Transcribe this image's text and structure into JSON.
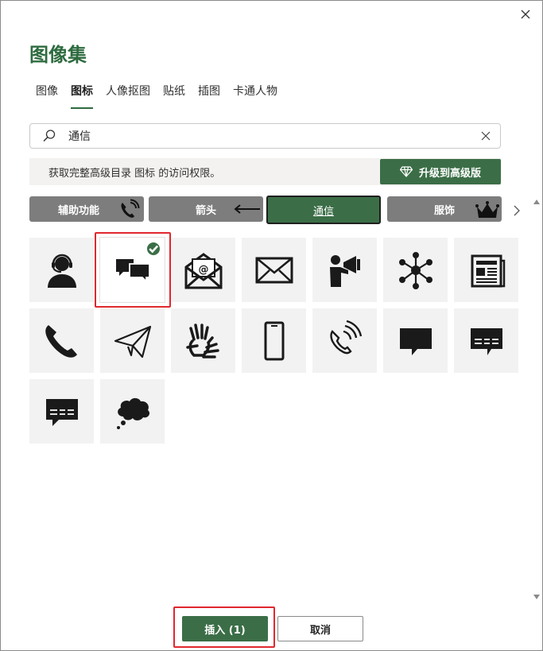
{
  "dialog": {
    "title": "图像集",
    "close_icon": "close-icon"
  },
  "tabs": [
    {
      "label": "图像",
      "active": false
    },
    {
      "label": "图标",
      "active": true
    },
    {
      "label": "人像抠图",
      "active": false
    },
    {
      "label": "贴纸",
      "active": false
    },
    {
      "label": "插图",
      "active": false
    },
    {
      "label": "卡通人物",
      "active": false
    }
  ],
  "search": {
    "value": "通信",
    "placeholder": "",
    "icon": "search-icon",
    "clear_icon": "close-icon"
  },
  "banner": {
    "message": "获取完整高级目录 图标 的访问权限。",
    "upgrade_label": "升级到高级版",
    "upgrade_icon": "diamond-icon"
  },
  "categories": [
    {
      "label": "辅助功能",
      "icon": "phone-volume-icon",
      "selected": false
    },
    {
      "label": "箭头",
      "icon": "arrow-left-icon",
      "selected": false
    },
    {
      "label": "通信",
      "icon": "",
      "selected": true
    },
    {
      "label": "服饰",
      "icon": "crown-icon",
      "selected": false
    }
  ],
  "icons": [
    {
      "name": "headset-person-icon",
      "selected": false
    },
    {
      "name": "chat-bubbles-icon",
      "selected": true
    },
    {
      "name": "open-envelope-at-icon",
      "selected": false
    },
    {
      "name": "envelope-icon",
      "selected": false
    },
    {
      "name": "person-megaphone-icon",
      "selected": false
    },
    {
      "name": "network-hub-icon",
      "selected": false
    },
    {
      "name": "newspaper-icon",
      "selected": false
    },
    {
      "name": "phone-handset-icon",
      "selected": false
    },
    {
      "name": "paper-plane-icon",
      "selected": false
    },
    {
      "name": "sign-language-icon",
      "selected": false
    },
    {
      "name": "mobile-phone-icon",
      "selected": false
    },
    {
      "name": "phone-ringing-icon",
      "selected": false
    },
    {
      "name": "speech-bubble-icon",
      "selected": false
    },
    {
      "name": "speech-bubble-dashes-icon",
      "selected": false
    },
    {
      "name": "speech-bubble-dashes-icon",
      "selected": false
    },
    {
      "name": "thought-cloud-icon",
      "selected": false
    }
  ],
  "colors": {
    "accent": "#3b6e47",
    "title": "#2e6b3f",
    "highlight": "#e0282e",
    "tile": "#f2f2f2",
    "category": "#7d7d7d"
  },
  "footer": {
    "insert_label": "插入 (1)",
    "cancel_label": "取消"
  }
}
